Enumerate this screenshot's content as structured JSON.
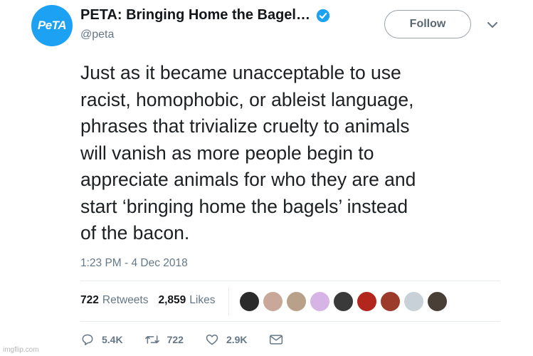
{
  "header": {
    "avatar_text": "PeTA",
    "display_name": "PETA: Bringing Home the Bagel…",
    "handle": "@peta",
    "follow_label": "Follow"
  },
  "tweet": {
    "text": "Just as it became unacceptable to use\nracist, homophobic, or ableist language,\nphrases that trivialize cruelty to animals\nwill vanish as more people begin to\nappreciate animals for who they are and\nstart ‘bringing home the bagels’ instead\nof the bacon.",
    "timestamp": "1:23 PM - 4 Dec 2018"
  },
  "stats": {
    "retweets_count": "722",
    "retweets_label": "Retweets",
    "likes_count": "2,859",
    "likes_label": "Likes"
  },
  "likers": [
    "#2b2b2b",
    "#c9a89a",
    "#b9a089",
    "#d7b4e6",
    "#3a3a3a",
    "#b3261e",
    "#9c3b2c",
    "#c8d0d8",
    "#4a3f36"
  ],
  "actions": {
    "replies": "5.4K",
    "retweets": "722",
    "likes": "2.9K"
  },
  "watermark": "imgflip.com",
  "colors": {
    "accent": "#1da1f2",
    "secondary_text": "#657786"
  }
}
